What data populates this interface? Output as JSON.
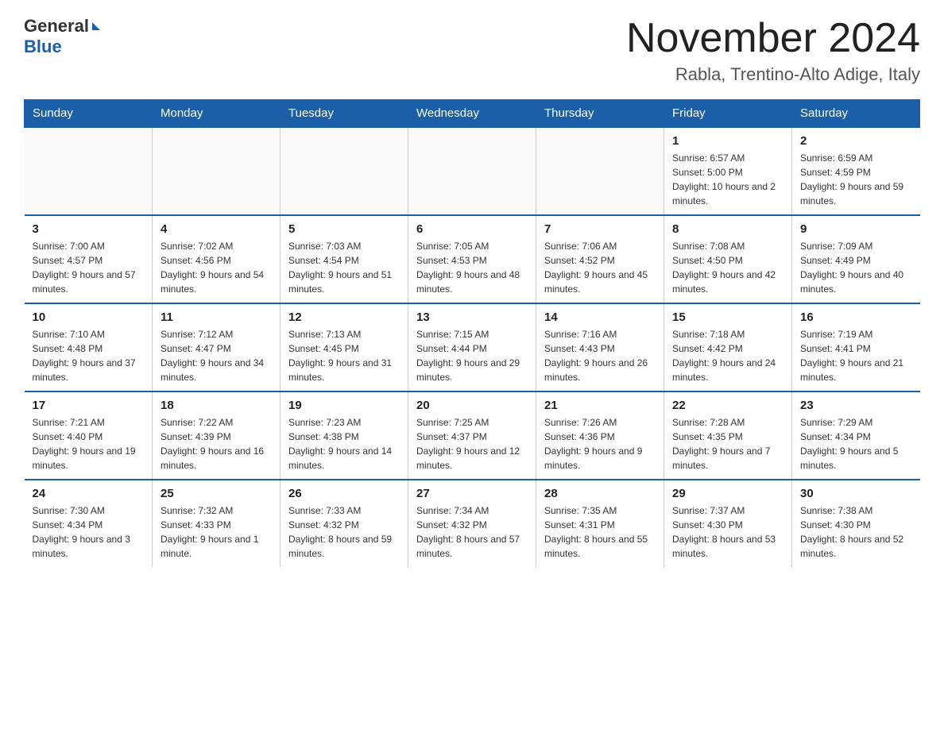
{
  "header": {
    "logo_general": "General",
    "logo_blue": "Blue",
    "month_title": "November 2024",
    "location": "Rabla, Trentino-Alto Adige, Italy"
  },
  "weekdays": [
    "Sunday",
    "Monday",
    "Tuesday",
    "Wednesday",
    "Thursday",
    "Friday",
    "Saturday"
  ],
  "weeks": [
    [
      {
        "day": "",
        "info": ""
      },
      {
        "day": "",
        "info": ""
      },
      {
        "day": "",
        "info": ""
      },
      {
        "day": "",
        "info": ""
      },
      {
        "day": "",
        "info": ""
      },
      {
        "day": "1",
        "info": "Sunrise: 6:57 AM\nSunset: 5:00 PM\nDaylight: 10 hours and 2 minutes."
      },
      {
        "day": "2",
        "info": "Sunrise: 6:59 AM\nSunset: 4:59 PM\nDaylight: 9 hours and 59 minutes."
      }
    ],
    [
      {
        "day": "3",
        "info": "Sunrise: 7:00 AM\nSunset: 4:57 PM\nDaylight: 9 hours and 57 minutes."
      },
      {
        "day": "4",
        "info": "Sunrise: 7:02 AM\nSunset: 4:56 PM\nDaylight: 9 hours and 54 minutes."
      },
      {
        "day": "5",
        "info": "Sunrise: 7:03 AM\nSunset: 4:54 PM\nDaylight: 9 hours and 51 minutes."
      },
      {
        "day": "6",
        "info": "Sunrise: 7:05 AM\nSunset: 4:53 PM\nDaylight: 9 hours and 48 minutes."
      },
      {
        "day": "7",
        "info": "Sunrise: 7:06 AM\nSunset: 4:52 PM\nDaylight: 9 hours and 45 minutes."
      },
      {
        "day": "8",
        "info": "Sunrise: 7:08 AM\nSunset: 4:50 PM\nDaylight: 9 hours and 42 minutes."
      },
      {
        "day": "9",
        "info": "Sunrise: 7:09 AM\nSunset: 4:49 PM\nDaylight: 9 hours and 40 minutes."
      }
    ],
    [
      {
        "day": "10",
        "info": "Sunrise: 7:10 AM\nSunset: 4:48 PM\nDaylight: 9 hours and 37 minutes."
      },
      {
        "day": "11",
        "info": "Sunrise: 7:12 AM\nSunset: 4:47 PM\nDaylight: 9 hours and 34 minutes."
      },
      {
        "day": "12",
        "info": "Sunrise: 7:13 AM\nSunset: 4:45 PM\nDaylight: 9 hours and 31 minutes."
      },
      {
        "day": "13",
        "info": "Sunrise: 7:15 AM\nSunset: 4:44 PM\nDaylight: 9 hours and 29 minutes."
      },
      {
        "day": "14",
        "info": "Sunrise: 7:16 AM\nSunset: 4:43 PM\nDaylight: 9 hours and 26 minutes."
      },
      {
        "day": "15",
        "info": "Sunrise: 7:18 AM\nSunset: 4:42 PM\nDaylight: 9 hours and 24 minutes."
      },
      {
        "day": "16",
        "info": "Sunrise: 7:19 AM\nSunset: 4:41 PM\nDaylight: 9 hours and 21 minutes."
      }
    ],
    [
      {
        "day": "17",
        "info": "Sunrise: 7:21 AM\nSunset: 4:40 PM\nDaylight: 9 hours and 19 minutes."
      },
      {
        "day": "18",
        "info": "Sunrise: 7:22 AM\nSunset: 4:39 PM\nDaylight: 9 hours and 16 minutes."
      },
      {
        "day": "19",
        "info": "Sunrise: 7:23 AM\nSunset: 4:38 PM\nDaylight: 9 hours and 14 minutes."
      },
      {
        "day": "20",
        "info": "Sunrise: 7:25 AM\nSunset: 4:37 PM\nDaylight: 9 hours and 12 minutes."
      },
      {
        "day": "21",
        "info": "Sunrise: 7:26 AM\nSunset: 4:36 PM\nDaylight: 9 hours and 9 minutes."
      },
      {
        "day": "22",
        "info": "Sunrise: 7:28 AM\nSunset: 4:35 PM\nDaylight: 9 hours and 7 minutes."
      },
      {
        "day": "23",
        "info": "Sunrise: 7:29 AM\nSunset: 4:34 PM\nDaylight: 9 hours and 5 minutes."
      }
    ],
    [
      {
        "day": "24",
        "info": "Sunrise: 7:30 AM\nSunset: 4:34 PM\nDaylight: 9 hours and 3 minutes."
      },
      {
        "day": "25",
        "info": "Sunrise: 7:32 AM\nSunset: 4:33 PM\nDaylight: 9 hours and 1 minute."
      },
      {
        "day": "26",
        "info": "Sunrise: 7:33 AM\nSunset: 4:32 PM\nDaylight: 8 hours and 59 minutes."
      },
      {
        "day": "27",
        "info": "Sunrise: 7:34 AM\nSunset: 4:32 PM\nDaylight: 8 hours and 57 minutes."
      },
      {
        "day": "28",
        "info": "Sunrise: 7:35 AM\nSunset: 4:31 PM\nDaylight: 8 hours and 55 minutes."
      },
      {
        "day": "29",
        "info": "Sunrise: 7:37 AM\nSunset: 4:30 PM\nDaylight: 8 hours and 53 minutes."
      },
      {
        "day": "30",
        "info": "Sunrise: 7:38 AM\nSunset: 4:30 PM\nDaylight: 8 hours and 52 minutes."
      }
    ]
  ]
}
